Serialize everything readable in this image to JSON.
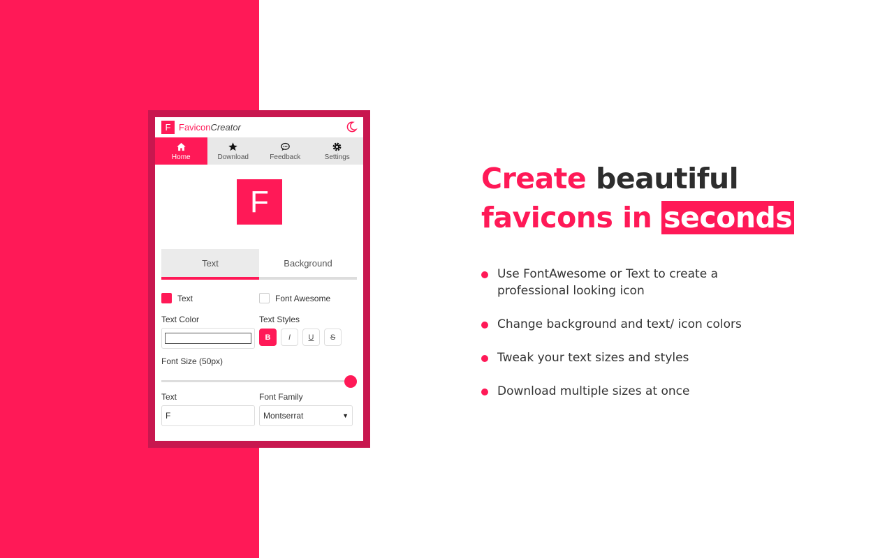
{
  "colors": {
    "accent": "#ff1957",
    "frame": "#c8174f",
    "text": "#2d2d2d"
  },
  "app": {
    "logo_letter": "F",
    "title_part1": "Favicon",
    "title_part2": "Creator",
    "theme_toggle_icon": "moon-icon"
  },
  "nav": [
    {
      "label": "Home",
      "icon": "home-icon",
      "active": true
    },
    {
      "label": "Download",
      "icon": "star-icon",
      "active": false
    },
    {
      "label": "Feedback",
      "icon": "comment-icon",
      "active": false
    },
    {
      "label": "Settings",
      "icon": "gear-icon",
      "active": false
    }
  ],
  "preview": {
    "letter": "F"
  },
  "tabs": [
    {
      "label": "Text",
      "active": true
    },
    {
      "label": "Background",
      "active": false
    }
  ],
  "form": {
    "type_text_label": "Text",
    "type_text_checked": true,
    "type_fa_label": "Font Awesome",
    "type_fa_checked": false,
    "text_color_label": "Text Color",
    "text_styles_label": "Text Styles",
    "styles": [
      {
        "label": "B",
        "name": "bold",
        "active": true
      },
      {
        "label": "I",
        "name": "italic",
        "active": false
      },
      {
        "label": "U",
        "name": "underline",
        "active": false
      },
      {
        "label": "S",
        "name": "strikethrough",
        "active": false
      }
    ],
    "font_size_label": "Font Size (50px)",
    "font_size_fraction": 1.0,
    "text_label": "Text",
    "text_value": "F",
    "font_family_label": "Font Family",
    "font_family_value": "Montserrat"
  },
  "hero": {
    "line1_pink": "Create",
    "line1_dark": "beautiful",
    "line2_pink": "favicons in",
    "line2_highlight": "seconds"
  },
  "features": [
    "Use FontAwesome or Text to create a professional looking icon",
    "Change background and text/ icon colors",
    "Tweak your text sizes and styles",
    "Download multiple sizes at once"
  ]
}
